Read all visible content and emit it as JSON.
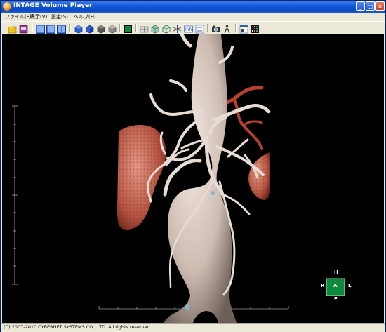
{
  "window": {
    "title": "INTAGE Volume Player",
    "buttons": {
      "minimize": "_",
      "maximize": "□",
      "close": "✕"
    }
  },
  "menu": [
    {
      "label": "ファイル(F)"
    },
    {
      "label": "表示(V)"
    },
    {
      "label": "設定(S)"
    },
    {
      "label": "ヘルプ(H)"
    }
  ],
  "toolbar": {
    "buttons": [
      {
        "name": "open-file-icon",
        "color": "#f0c419"
      },
      {
        "name": "save-image-icon",
        "color": "#8e3a8e"
      },
      {
        "name": "layout-single-icon",
        "color": "#4a7ad6"
      },
      {
        "name": "layout-dual-icon",
        "color": "#4a7ad6"
      },
      {
        "name": "layout-quad-icon",
        "color": "#4a7ad6"
      },
      {
        "name": "cube-front-icon",
        "color": "#2d5fd8"
      },
      {
        "name": "cube-side-icon",
        "color": "#2d5fd8"
      },
      {
        "name": "cube-gray-icon",
        "color": "#555555"
      },
      {
        "name": "cube-light-icon",
        "color": "#888888"
      },
      {
        "name": "green-square-icon",
        "color": "#0e8a3c"
      },
      {
        "name": "mpr-icon",
        "color": "#6a6a6a"
      },
      {
        "name": "volume-icon",
        "color": "#2a8a6a"
      },
      {
        "name": "clip-box-icon",
        "color": "#2a8a6a"
      },
      {
        "name": "axis-icon",
        "color": "#c03030"
      },
      {
        "name": "info-icon",
        "color": "#2040c0"
      },
      {
        "name": "list-icon",
        "color": "#4060a0"
      },
      {
        "name": "camera-icon",
        "color": "#303030"
      },
      {
        "name": "figure-icon",
        "color": "#404040"
      },
      {
        "name": "window-icon",
        "color": "#3060c0"
      },
      {
        "name": "palette-icon",
        "color": "#c02020"
      }
    ]
  },
  "viewport": {
    "background": "#000000",
    "orientation": {
      "top": "H",
      "bottom": "F",
      "left": "R",
      "right": "L",
      "center": "A",
      "center_color": "#0e8a3c"
    }
  },
  "status": {
    "text": "(C) 2007-2010 CYBERNET SYSTEMS CO., LTD. All rights reserved."
  }
}
